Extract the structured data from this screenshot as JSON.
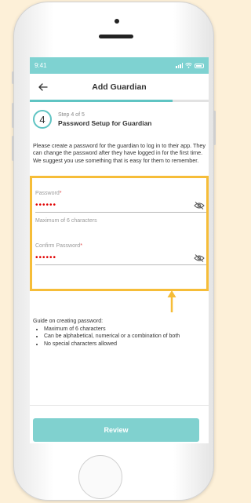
{
  "status_bar": {
    "time": "9:41"
  },
  "header": {
    "title": "Add Guardian",
    "back_icon": "arrow-left-icon"
  },
  "progress": {
    "fraction": 0.8,
    "color": "#5fc4c3"
  },
  "step": {
    "number": "4",
    "label": "Step 4 of 5",
    "title": "Password Setup for Guardian"
  },
  "intro_text": "Please create a password for the guardian to log in to their app. They can change the password after they have logged in for the first time. We suggest you use something that is easy for them to remember.",
  "form": {
    "password": {
      "label": "Password",
      "required_mark": "*",
      "value_masked": "••••••",
      "hint": "Maximum of 6 characters",
      "visibility_icon": "eye-off-icon"
    },
    "confirm_password": {
      "label": "Confirm Password",
      "required_mark": "*",
      "value_masked": "••••••",
      "visibility_icon": "eye-off-icon"
    }
  },
  "guide": {
    "title": "Guide on creating password:",
    "items": [
      "Maximum of 6 characters",
      "Can be alphabetical, numerical or a combination of both",
      "No special characters allowed"
    ]
  },
  "review_button": {
    "label": "Review"
  },
  "colors": {
    "accent": "#5fc4c3",
    "status_bar": "#7ed2d1",
    "highlight_border": "#f6bd38",
    "masked_text": "#e00000",
    "page_background": "#fdf0d8"
  }
}
